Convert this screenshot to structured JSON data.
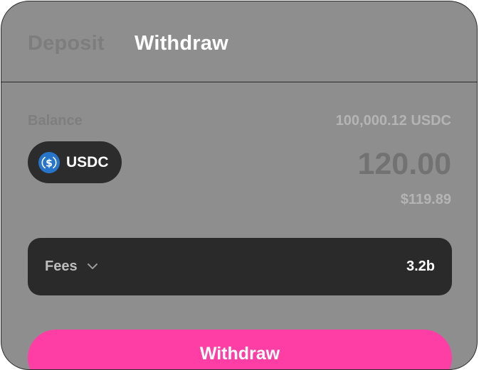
{
  "tabs": {
    "deposit_label": "Deposit",
    "withdraw_label": "Withdraw",
    "active": "Withdraw"
  },
  "balance": {
    "label": "Balance",
    "value": "100,000.12 USDC"
  },
  "token": {
    "symbol": "USDC",
    "icon": "usdc-coin-icon"
  },
  "amount": {
    "value": "120.00",
    "usd": "$119.89"
  },
  "fees": {
    "label": "Fees",
    "value": "3.2b"
  },
  "action": {
    "label": "Withdraw"
  },
  "colors": {
    "panel": "#8e8e8e",
    "pill": "#2c2c2c",
    "accent": "#ff3ea5",
    "usdc_blue": "#2775ca"
  }
}
